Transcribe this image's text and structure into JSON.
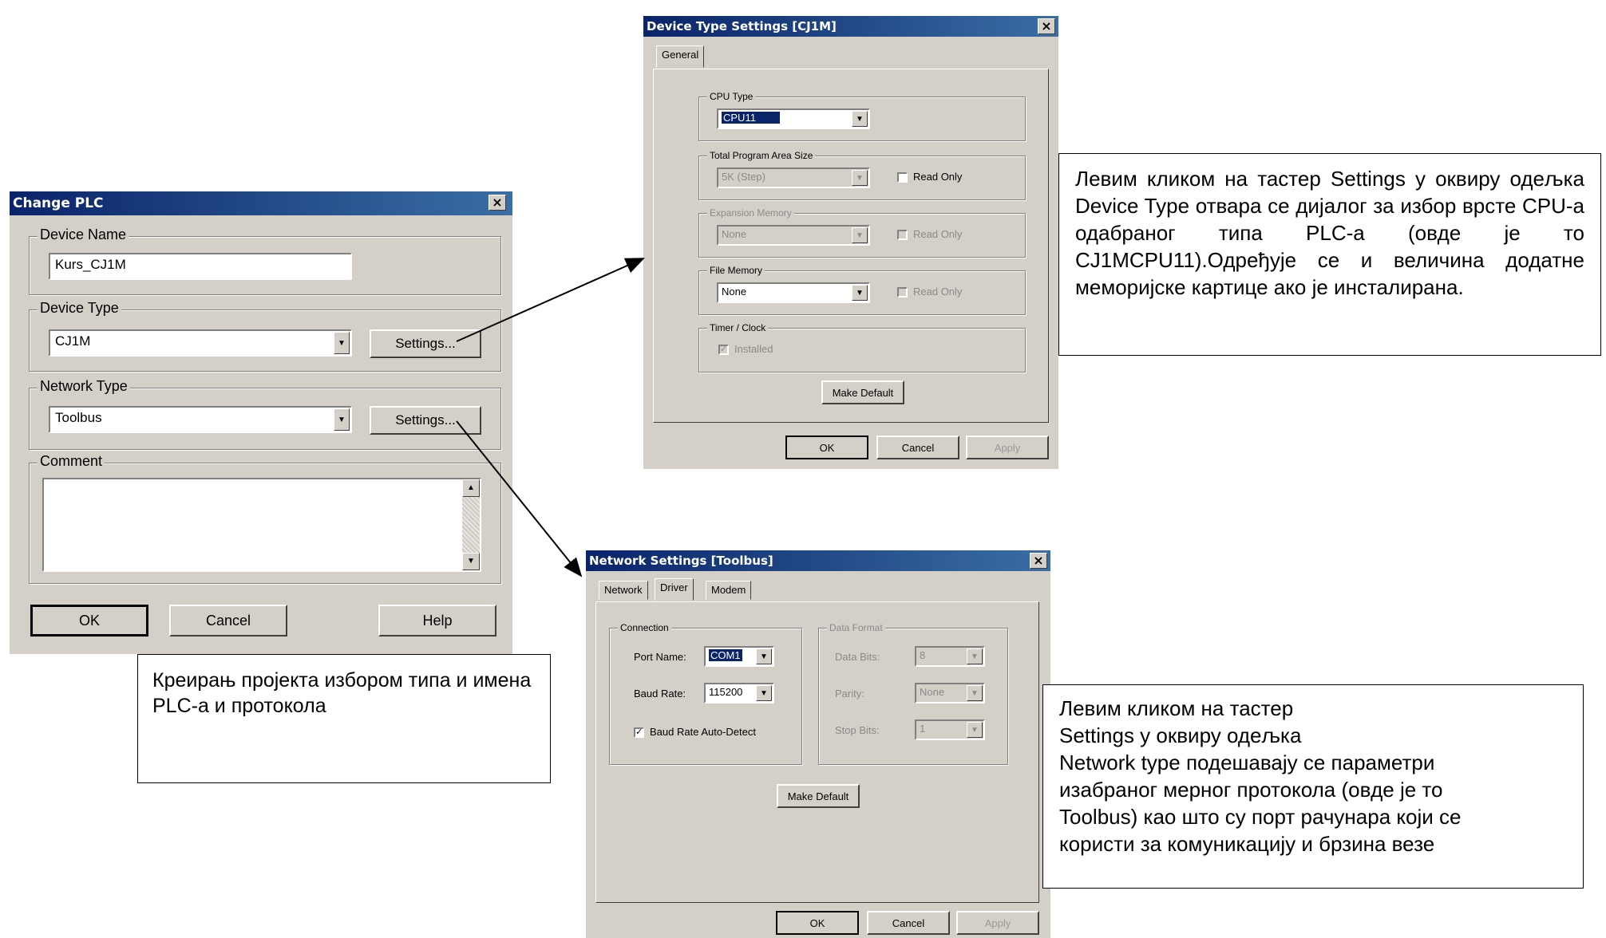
{
  "change_plc": {
    "title": "Change PLC",
    "close": "×",
    "device_name_label": "Device Name",
    "device_name_value": "Kurs_CJ1M",
    "device_type_label": "Device Type",
    "device_type_value": "CJ1M",
    "settings_label_1": "Settings...",
    "network_type_label": "Network Type",
    "network_type_value": "Toolbus",
    "settings_label_2": "Settings...",
    "comment_label": "Comment",
    "ok": "OK",
    "cancel": "Cancel",
    "help": "Help"
  },
  "device_type_settings": {
    "title": "Device Type Settings [CJ1M]",
    "close": "×",
    "tab_general": "General",
    "cpu_type_label": "CPU Type",
    "cpu_type_value": "CPU11",
    "program_area_label": "Total Program Area Size",
    "program_area_value": "5K (Step)",
    "read_only_1": "Read Only",
    "expansion_label": "Expansion Memory",
    "expansion_value": "None",
    "read_only_2": "Read Only",
    "file_memory_label": "File Memory",
    "file_memory_value": "None",
    "read_only_3": "Read Only",
    "timer_clock_label": "Timer / Clock",
    "installed": "Installed",
    "make_default": "Make Default",
    "ok": "OK",
    "cancel": "Cancel",
    "apply": "Apply"
  },
  "network_settings": {
    "title": "Network Settings [Toolbus]",
    "close": "×",
    "tabs": [
      "Network",
      "Driver",
      "Modem"
    ],
    "connection_label": "Connection",
    "port_name_label": "Port Name:",
    "port_name_value": "COM1",
    "baud_rate_label": "Baud Rate:",
    "baud_rate_value": "115200",
    "auto_detect": "Baud Rate Auto-Detect",
    "data_format_label": "Data Format",
    "data_bits_label": "Data Bits:",
    "data_bits_value": "8",
    "parity_label": "Parity:",
    "parity_value": "None",
    "stop_bits_label": "Stop Bits:",
    "stop_bits_value": "1",
    "make_default": "Make Default",
    "ok": "OK",
    "cancel": "Cancel",
    "apply": "Apply"
  },
  "notes": {
    "device_type": "Левим кликом на тастер Settings у оквиру одељка Device Type отвара се дијалог за избор врсте CPU-а одабраног типа PLC-а (овде је то CJ1MCPU11).Одређује се и величина додатне меморијске картице ако је инсталирана.",
    "project": "Креирањ пројекта избором типа и имена PLC-а и протокола",
    "network_lines": [
      "Левим кликом на тастер",
      "Settings у оквиру одељка",
      "Network type подешавају се параметри",
      "изабраног мерног протокола (овде је то",
      "Toolbus) као што су порт рачунара који се",
      "користи за комуникацију и брзина везе"
    ]
  }
}
